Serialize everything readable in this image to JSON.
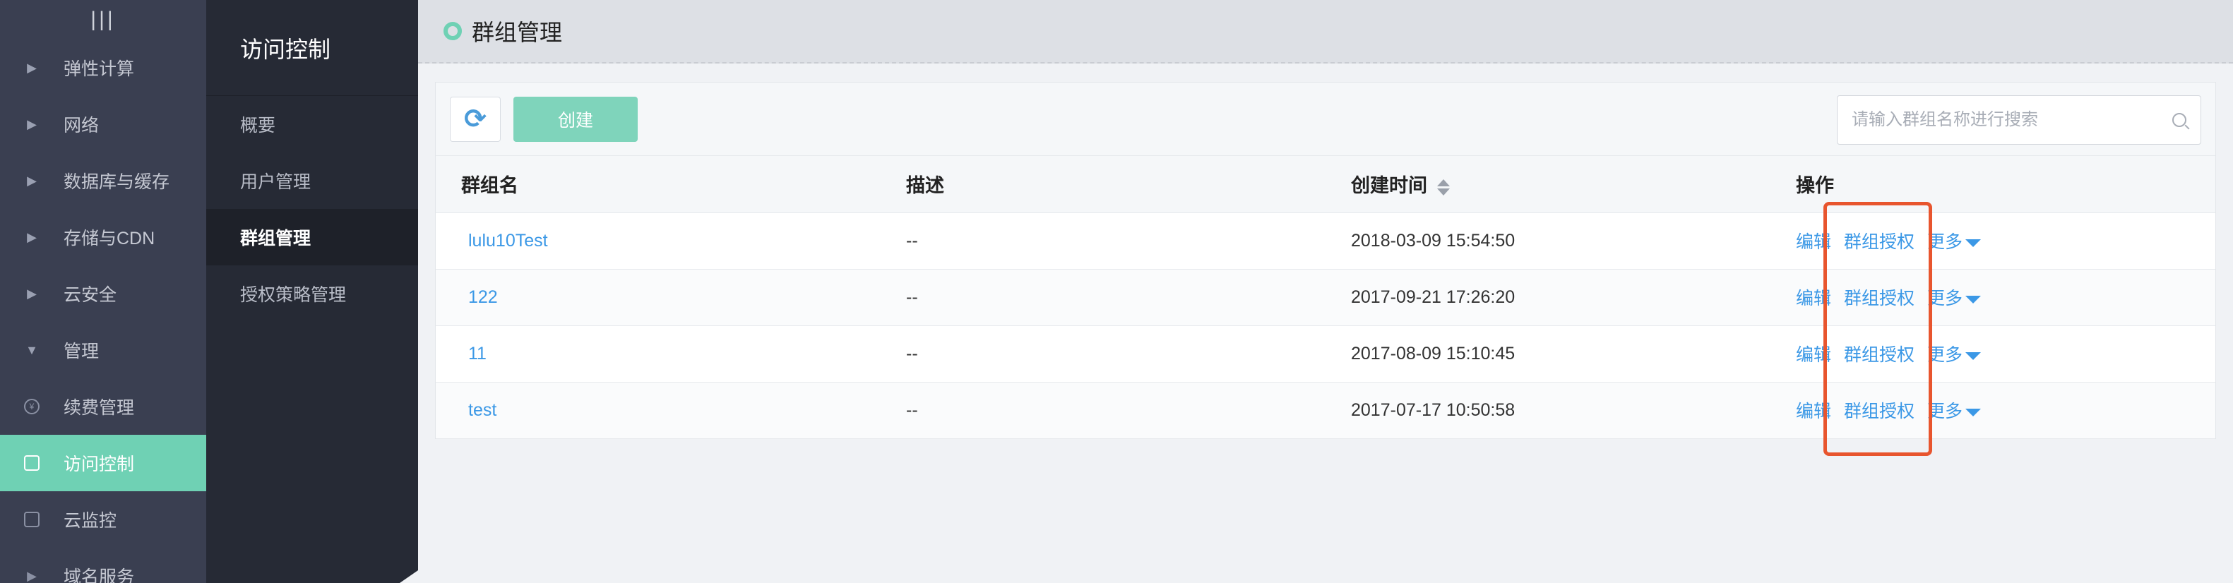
{
  "nav": {
    "menu_glyph": "|||",
    "items": [
      {
        "label": "弹性计算",
        "icon": "caret-right-icon"
      },
      {
        "label": "网络",
        "icon": "caret-right-icon"
      },
      {
        "label": "数据库与缓存",
        "icon": "caret-right-icon"
      },
      {
        "label": "存储与CDN",
        "icon": "caret-right-icon"
      },
      {
        "label": "云安全",
        "icon": "caret-right-icon"
      },
      {
        "label": "管理",
        "icon": "caret-down-icon"
      }
    ],
    "sub_items": [
      {
        "label": "续费管理",
        "icon": "yen-icon"
      },
      {
        "label": "访问控制",
        "icon": "user-card-icon"
      },
      {
        "label": "云监控",
        "icon": "monitor-icon"
      },
      {
        "label": "域名服务",
        "icon": "caret-right-icon"
      }
    ]
  },
  "subnav": {
    "title": "访问控制",
    "items": [
      "概要",
      "用户管理",
      "群组管理",
      "授权策略管理"
    ],
    "active_index": 2
  },
  "main": {
    "title": "群组管理",
    "toolbar": {
      "create_label": "创建",
      "search_placeholder": "请输入群组名称进行搜索"
    },
    "table": {
      "headers": [
        "群组名",
        "描述",
        "创建时间",
        "操作"
      ],
      "rows": [
        {
          "name": "lulu10Test",
          "desc": "--",
          "created": "2018-03-09 15:54:50"
        },
        {
          "name": "122",
          "desc": "--",
          "created": "2017-09-21 17:26:20"
        },
        {
          "name": "11",
          "desc": "--",
          "created": "2017-08-09 15:10:45"
        },
        {
          "name": "test",
          "desc": "--",
          "created": "2017-07-17 10:50:58"
        }
      ],
      "ops": {
        "edit": "编辑",
        "authorize": "群组授权",
        "more": "更多"
      }
    }
  },
  "colors": {
    "accent": "#6fd1b4",
    "link": "#3b98e6",
    "highlight_box": "#e8552e"
  }
}
